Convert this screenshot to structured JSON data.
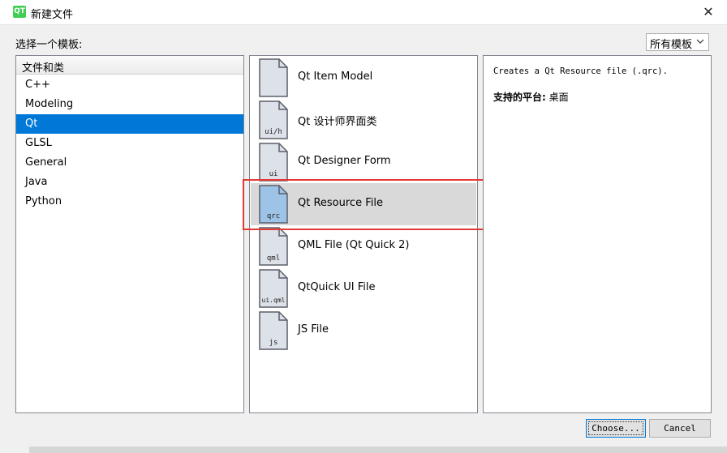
{
  "window": {
    "title": "新建文件",
    "app_icon_text": "QT",
    "close_glyph": "✕"
  },
  "chooser": {
    "label": "选择一个模板:",
    "filter": {
      "selected": "所有模板"
    }
  },
  "categories": {
    "header": "文件和类",
    "items": [
      "C++",
      "Modeling",
      "Qt",
      "GLSL",
      "General",
      "Java",
      "Python"
    ],
    "selected": "Qt"
  },
  "templates": {
    "items": [
      {
        "label": "Qt Item Model",
        "icon_text": ""
      },
      {
        "label": "Qt 设计师界面类",
        "icon_text": "ui/h"
      },
      {
        "label": "Qt Designer Form",
        "icon_text": "ui"
      },
      {
        "label": "Qt Resource File",
        "icon_text": "qrc"
      },
      {
        "label": "QML File (Qt Quick 2)",
        "icon_text": "qml"
      },
      {
        "label": "QtQuick UI File",
        "icon_text": "ui.qml"
      },
      {
        "label": "JS File",
        "icon_text": "js"
      }
    ],
    "selected": "Qt Resource File",
    "highlight_color": "#e53935"
  },
  "description": {
    "text": "Creates a Qt Resource file (.qrc).",
    "platform_label": "支持的平台:",
    "platform_value": " 桌面"
  },
  "buttons": {
    "choose": "Choose...",
    "cancel": "Cancel"
  },
  "colors": {
    "selection": "#0078d7",
    "qt_green": "#41cd52",
    "file_icon": "#dde1e8",
    "file_icon_selected": "#9dc3e6"
  }
}
